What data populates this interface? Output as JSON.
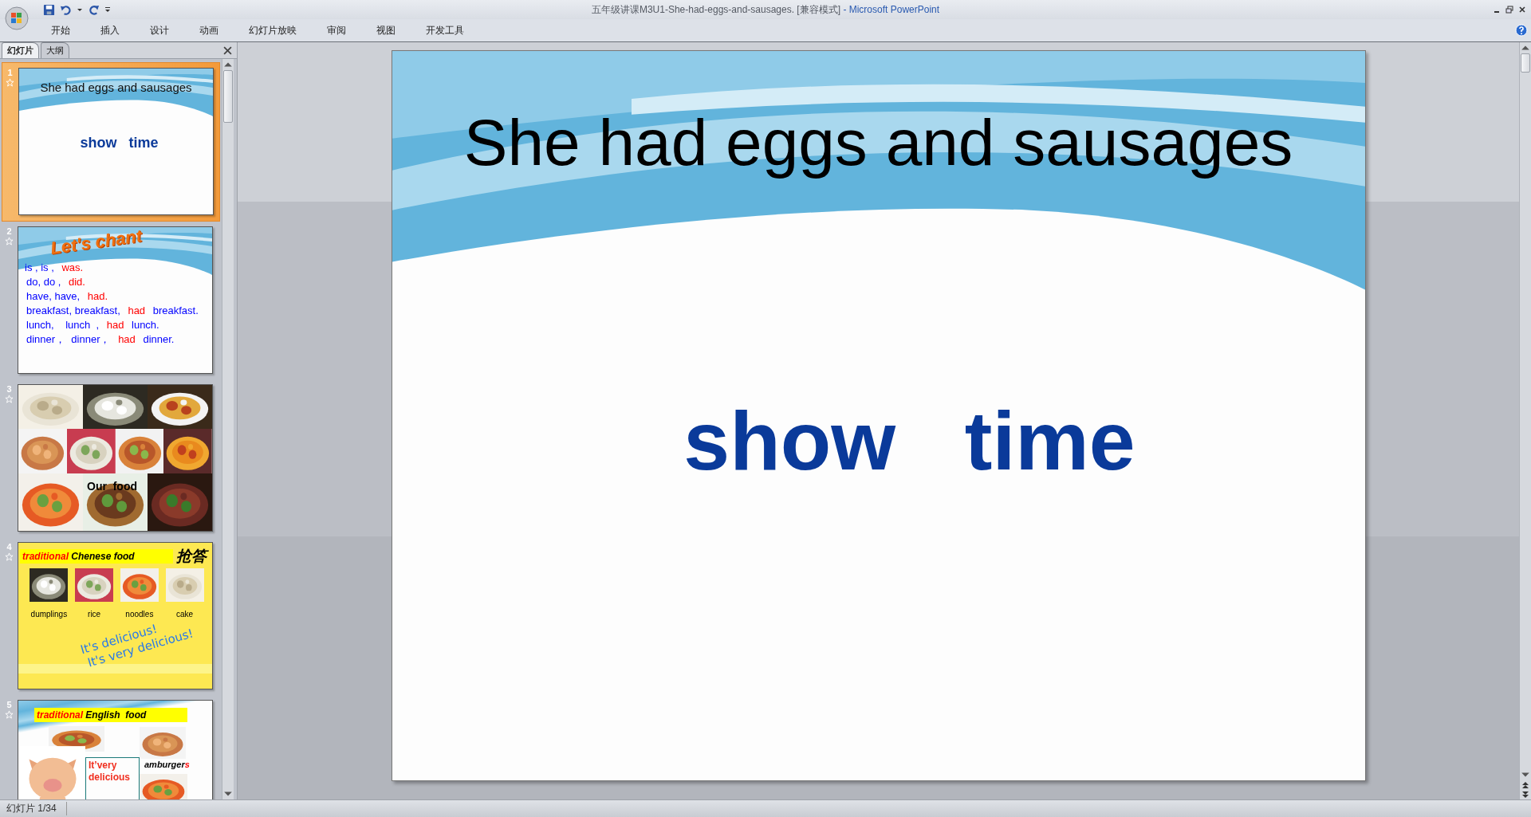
{
  "window": {
    "title": "五年级讲课M3U1-She-had-eggs-and-sausages. [兼容模式]",
    "app_name": "- Microsoft PowerPoint"
  },
  "ribbon_tabs": [
    "开始",
    "插入",
    "设计",
    "动画",
    "幻灯片放映",
    "审阅",
    "视图",
    "开发工具"
  ],
  "panel_tabs": [
    {
      "label": "幻灯片",
      "selected": true
    },
    {
      "label": "大纲",
      "selected": false
    }
  ],
  "thumbnails": [
    {
      "number": "1",
      "selected": true,
      "kind": "title",
      "title": "She had eggs and sausages",
      "subtitle": "show   time"
    },
    {
      "number": "2",
      "selected": false,
      "kind": "chant",
      "heading": "Let's chant",
      "lines": [
        [
          {
            "text": "is , is ,",
            "color": "#0000ff"
          },
          {
            "text": "was.",
            "color": "#ff0000"
          }
        ],
        [
          {
            "text": "do, do ,",
            "color": "#0000ff"
          },
          {
            "text": "did.",
            "color": "#ff0000"
          }
        ],
        [
          {
            "text": "have, have,",
            "color": "#0000ff"
          },
          {
            "text": "had.",
            "color": "#ff0000"
          }
        ],
        [
          {
            "text": "breakfast, breakfast,",
            "color": "#0000ff"
          },
          {
            "text": "had",
            "color": "#ff0000"
          },
          {
            "text": "breakfast.",
            "color": "#0000ff"
          }
        ],
        [
          {
            "text": "lunch,    lunch  ,",
            "color": "#0000ff"
          },
          {
            "text": "had",
            "color": "#ff0000"
          },
          {
            "text": "lunch.",
            "color": "#0000ff"
          }
        ],
        [
          {
            "text": "dinner，  dinner，",
            "color": "#0000ff"
          },
          {
            "text": "had",
            "color": "#ff0000"
          },
          {
            "text": "dinner.",
            "color": "#0000ff"
          }
        ]
      ]
    },
    {
      "number": "3",
      "selected": false,
      "kind": "collage",
      "caption": "Our  food"
    },
    {
      "number": "4",
      "selected": false,
      "kind": "food_grid",
      "heading": [
        {
          "text": "traditional",
          "color": "#ff0000"
        },
        {
          "text": "Chenese food",
          "color": "#000000"
        }
      ],
      "badge": "抢答",
      "items": [
        "dumplings",
        "rice",
        "noodles",
        "cake"
      ],
      "slogans": [
        "It's delicious!",
        "It's very delicious!"
      ]
    },
    {
      "number": "5",
      "selected": false,
      "kind": "food_pig",
      "heading": [
        {
          "text": "traditional",
          "color": "#ff0000"
        },
        {
          "text": "English  food",
          "color": "#000000"
        }
      ],
      "label": [
        {
          "text": "amburger",
          "color": "#000000"
        },
        {
          "text": "s",
          "color": "#ff0000"
        }
      ],
      "speech": "It’very delicious"
    }
  ],
  "slide": {
    "title": "She had eggs and sausages",
    "subtitle": "show   time"
  },
  "status_bar": {
    "slide_counter": "幻灯片 1/34"
  }
}
